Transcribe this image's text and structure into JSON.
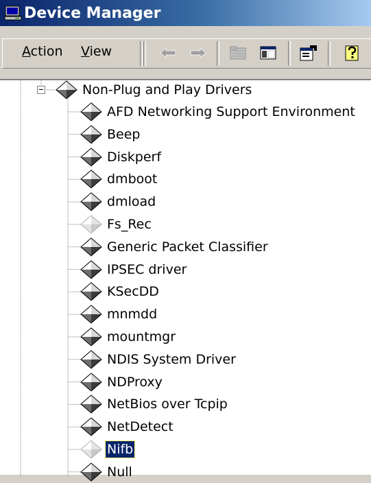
{
  "window": {
    "title": "Device Manager"
  },
  "toolbar": {
    "menus": [
      {
        "label": "Action",
        "accel": "A",
        "rest": "ction"
      },
      {
        "label": "View",
        "accel": "V",
        "rest": "iew"
      }
    ],
    "buttons": [
      "back-arrow-icon",
      "forward-arrow-icon",
      "up-folder-icon",
      "show-hide-console-tree-icon",
      "properties-icon",
      "help-icon"
    ]
  },
  "tree": {
    "parent": {
      "label": "Non-Plug and Play Drivers",
      "expanded": true
    },
    "children": [
      {
        "label": "AFD Networking Support Environment",
        "state": "normal"
      },
      {
        "label": "Beep",
        "state": "normal"
      },
      {
        "label": "Diskperf",
        "state": "normal"
      },
      {
        "label": "dmboot",
        "state": "normal"
      },
      {
        "label": "dmload",
        "state": "normal"
      },
      {
        "label": "Fs_Rec",
        "state": "disabled"
      },
      {
        "label": "Generic Packet Classifier",
        "state": "normal"
      },
      {
        "label": "IPSEC driver",
        "state": "normal"
      },
      {
        "label": "KSecDD",
        "state": "normal"
      },
      {
        "label": "mnmdd",
        "state": "normal"
      },
      {
        "label": "mountmgr",
        "state": "normal"
      },
      {
        "label": "NDIS System Driver",
        "state": "normal"
      },
      {
        "label": "NDProxy",
        "state": "normal"
      },
      {
        "label": "NetBios over Tcpip",
        "state": "normal"
      },
      {
        "label": "NetDetect",
        "state": "normal"
      },
      {
        "label": "Nifb",
        "state": "disabled",
        "selected": true
      },
      {
        "label": "Null",
        "state": "normal"
      }
    ]
  },
  "colors": {
    "title_start": "#0a246a",
    "title_end": "#a6caf0",
    "face": "#d4d0c8",
    "selection": "#0a246a"
  }
}
